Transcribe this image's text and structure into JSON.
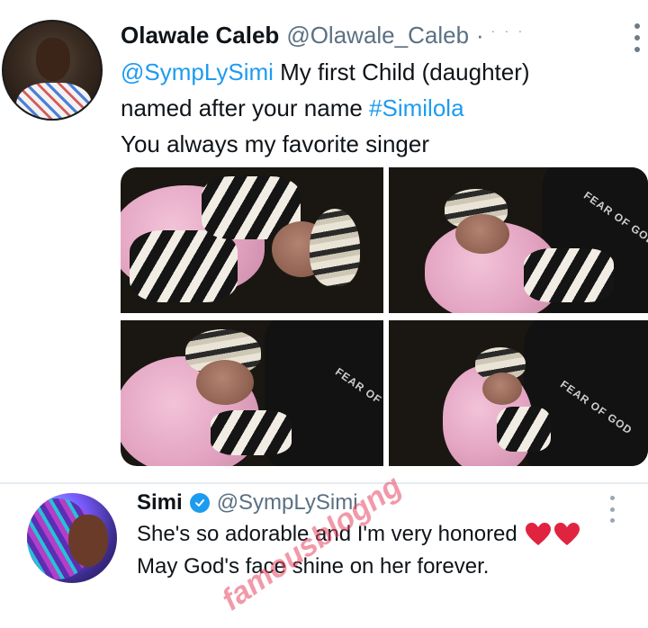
{
  "tweet1": {
    "display_name": "Olawale Caleb",
    "handle": "@Olawale_Caleb",
    "separator": "·",
    "lines": {
      "mention": "@SympLySimi",
      "line1_rest": " My first Child (daughter)",
      "line2_start": "named after your name ",
      "hashtag": "#Similola",
      "line3": "You always my favorite singer"
    },
    "media": {
      "photos": [
        {
          "caption": ""
        },
        {
          "caption": "FEAR OF GOD"
        },
        {
          "caption": "FEAR OF"
        },
        {
          "caption": "FEAR OF GOD"
        }
      ]
    }
  },
  "tweet2": {
    "display_name": "Simi",
    "handle": "@SympLySimi",
    "line1": "She's so adorable and I'm very honored",
    "line2": "May God's face shine on her forever."
  },
  "watermark": "famousblogng",
  "colors": {
    "link": "#1d9bf0",
    "handle": "#5b7083",
    "verified": "#1d9bf0",
    "heart": "#e0243f"
  },
  "icons": {
    "more": "more-vertical-icon",
    "verified": "verified-badge-icon",
    "heart": "red-heart-icon"
  }
}
